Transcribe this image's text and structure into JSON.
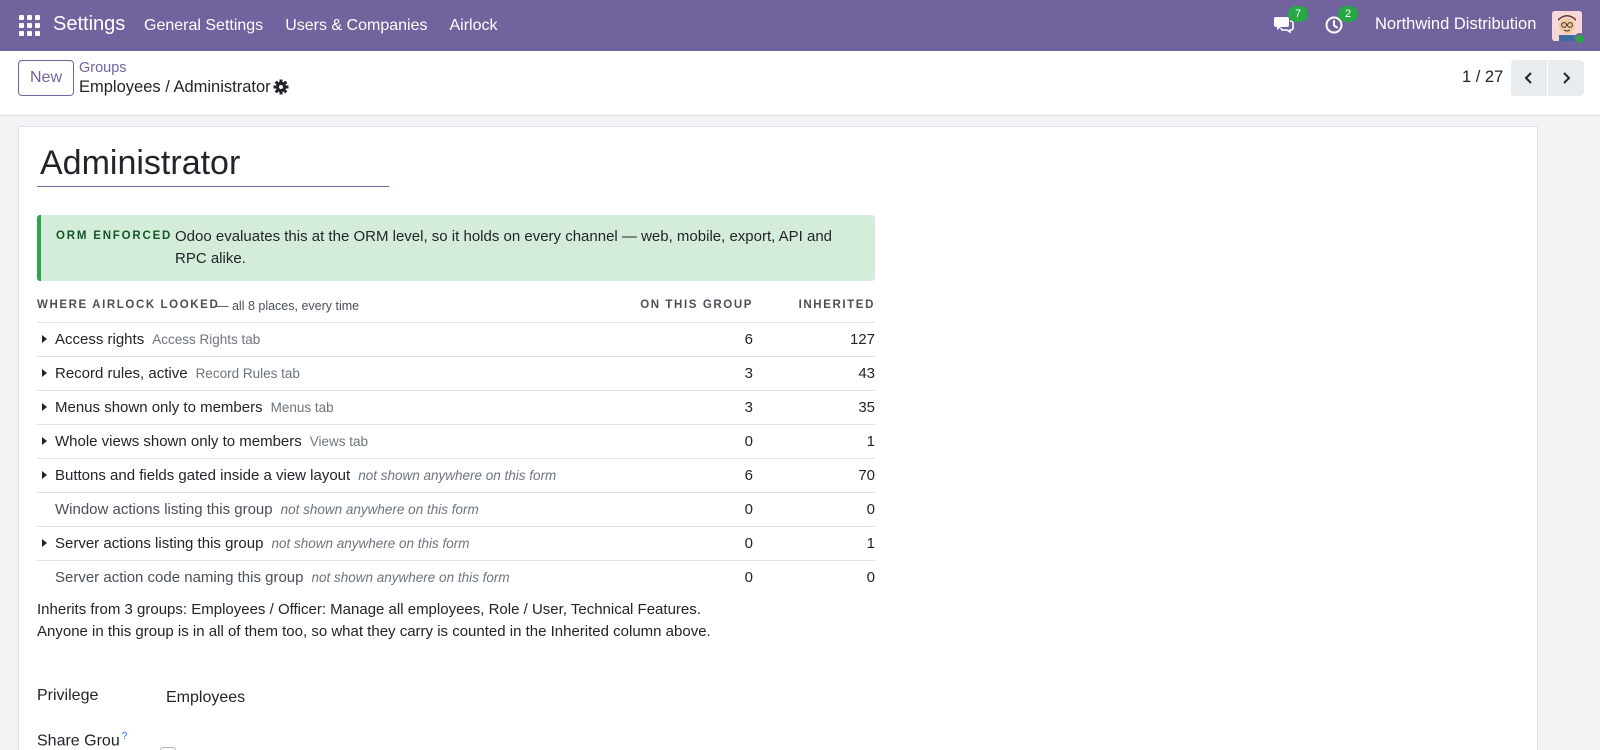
{
  "navbar": {
    "brand": "Settings",
    "menu": [
      "General Settings",
      "Users & Companies",
      "Airlock"
    ],
    "messages_count": "7",
    "activities_count": "2",
    "company": "Northwind Distribution",
    "bg_color": "#71639e",
    "badge_color": "#28a745"
  },
  "control_panel": {
    "new_label": "New",
    "breadcrumb_parent": "Groups",
    "breadcrumb_current": "Employees / Administrator",
    "pager": "1 / 27"
  },
  "form": {
    "name": "Administrator",
    "alert": {
      "tag": "ORM ENFORCED",
      "text": "Odoo evaluates this at the ORM level, so it holds on every channel — web, mobile, export, API and RPC alike.",
      "color": "#d4edda"
    },
    "table": {
      "title": "WHERE AIRLOCK LOOKED",
      "subtitle": "— all 8 places, every time",
      "col_own": "ON THIS GROUP",
      "col_inherited": "INHERITED",
      "rows": [
        {
          "label": "Access rights",
          "hint": "Access Rights tab",
          "own": "6",
          "inherited": "127"
        },
        {
          "label": "Record rules, active",
          "hint": "Record Rules tab",
          "own": "3",
          "inherited": "43"
        },
        {
          "label": "Menus shown only to members",
          "hint": "Menus tab",
          "own": "3",
          "inherited": "35"
        },
        {
          "label": "Whole views shown only to members",
          "hint": "Views tab",
          "own": "0",
          "inherited": "1"
        },
        {
          "label": "Buttons and fields gated inside a view layout",
          "hint": "not shown anywhere on this form",
          "own": "6",
          "inherited": "70"
        },
        {
          "label": "Window actions listing this group",
          "hint": "not shown anywhere on this form",
          "own": "0",
          "inherited": "0"
        },
        {
          "label": "Server actions listing this group",
          "hint": "not shown anywhere on this form",
          "own": "0",
          "inherited": "1"
        },
        {
          "label": "Server action code naming this group",
          "hint": "not shown anywhere on this form",
          "own": "0",
          "inherited": "0"
        }
      ]
    },
    "inherit_note": "Inherits from 3 groups: Employees / Officer: Manage all employees, Role / User, Technical Features. Anyone in this group is in all of them too, so what they carry is counted in the Inherited column above.",
    "privilege_label": "Privilege",
    "privilege_value": "Employees",
    "share_label": "Share Grou",
    "share_help": "?"
  }
}
